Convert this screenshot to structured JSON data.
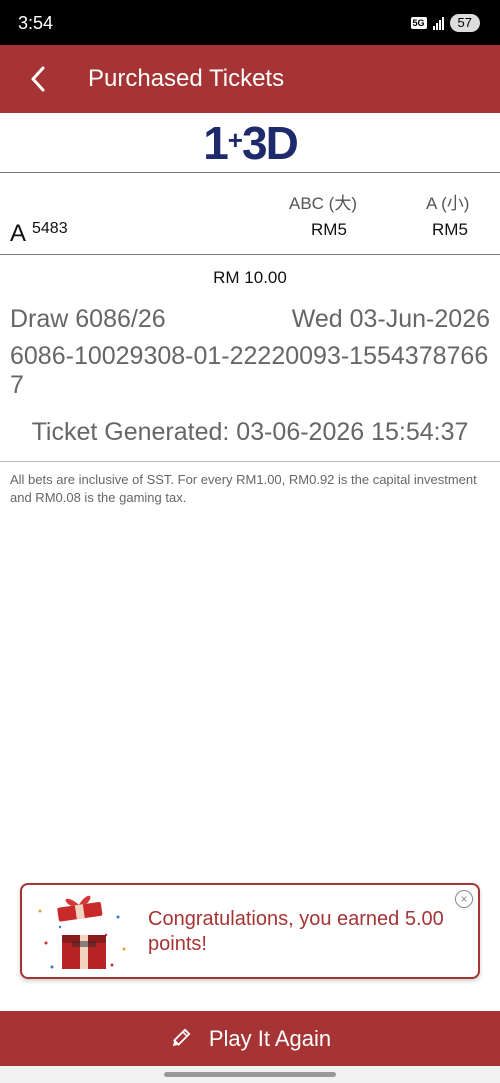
{
  "status_bar": {
    "time": "3:54",
    "network": "5G",
    "battery": "57"
  },
  "header": {
    "title": "Purchased Tickets"
  },
  "logo": {
    "left": "1",
    "plus": "+",
    "right": "3D"
  },
  "bet_table": {
    "columns": [
      "ABC (大)",
      "A (小)"
    ],
    "row": {
      "letter": "A",
      "number": "5483",
      "values": [
        "RM5",
        "RM5"
      ]
    }
  },
  "summary": {
    "total": "RM 10.00",
    "draw": "Draw 6086/26",
    "date": "Wed 03-Jun-2026",
    "ticket_id": "6086-10029308-01-22220093-15543787667",
    "generated": "Ticket Generated: 03-06-2026 15:54:37"
  },
  "disclaimer": "All bets are inclusive of SST. For every RM1.00, RM0.92 is the capital investment and RM0.08 is the gaming tax.",
  "toast": {
    "message": "Congratulations, you earned 5.00 points!",
    "close_symbol": "×"
  },
  "footer": {
    "play_again_label": "Play It Again"
  },
  "colors": {
    "brand_red": "#a63434",
    "logo_navy": "#1e2a6b"
  }
}
